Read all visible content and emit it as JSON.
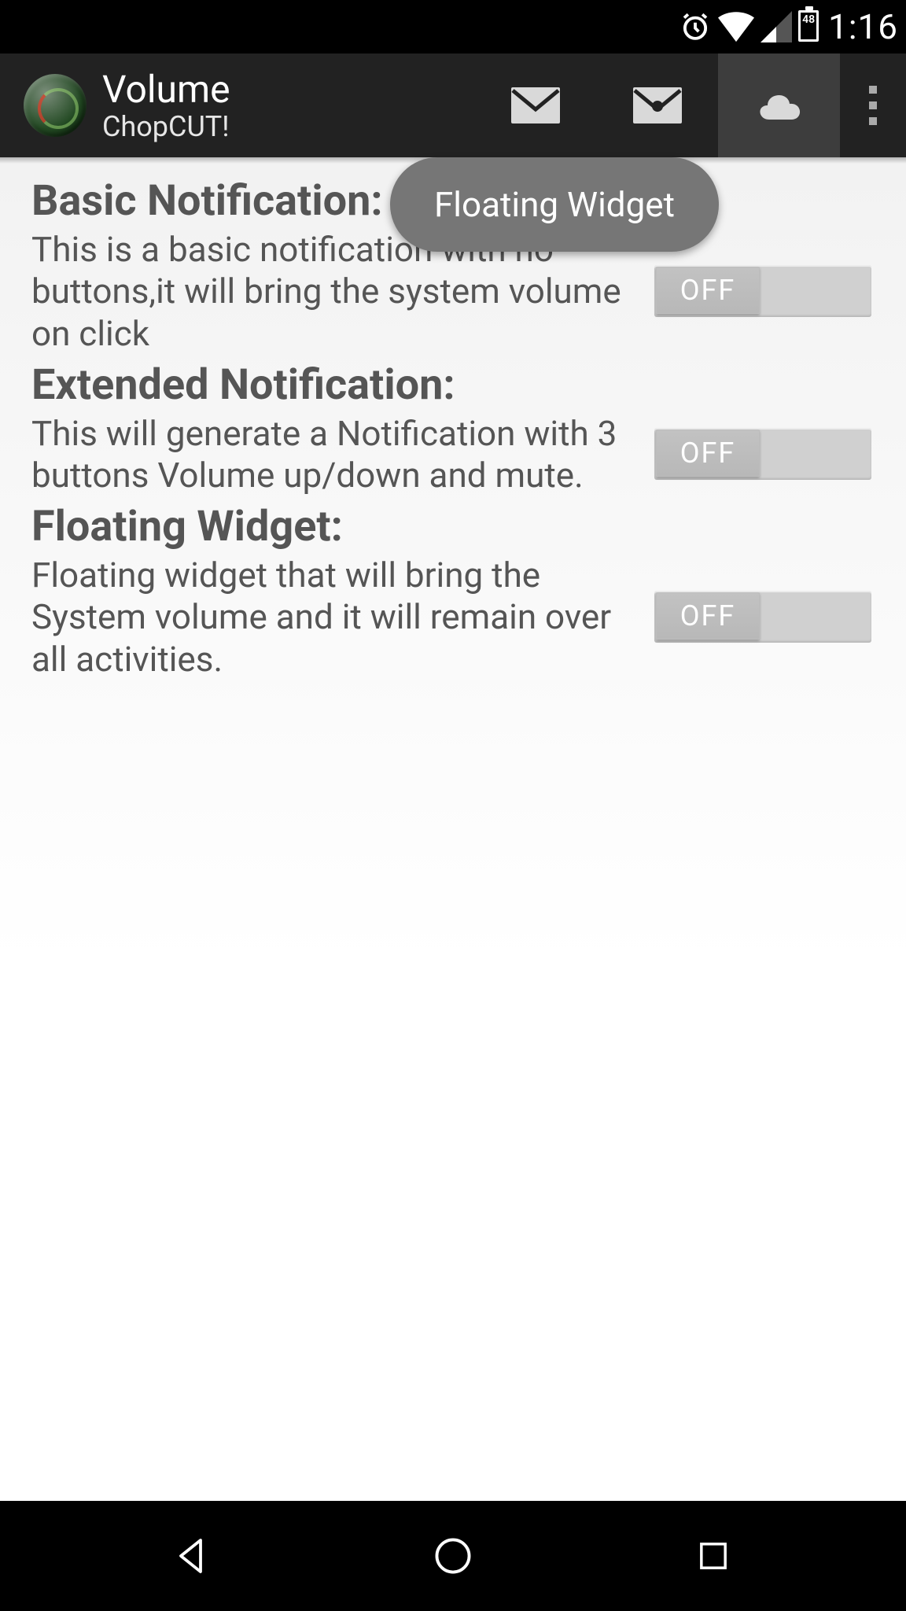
{
  "status_bar": {
    "battery_percent": "48",
    "time": "1:16"
  },
  "action_bar": {
    "title": "Volume",
    "subtitle": "ChopCUT!"
  },
  "tooltip": {
    "text": "Floating Widget"
  },
  "sections": [
    {
      "title": "Basic Notification:",
      "desc": "This is a basic notification with no buttons,it will bring the system volume on click",
      "toggle": "OFF"
    },
    {
      "title": "Extended Notification:",
      "desc": "This will generate a Notification with 3 buttons Volume up/down and mute.",
      "toggle": "OFF"
    },
    {
      "title": "Floating Widget:",
      "desc": "Floating widget that will bring the System volume and it will remain over all activities.",
      "toggle": "OFF"
    }
  ]
}
